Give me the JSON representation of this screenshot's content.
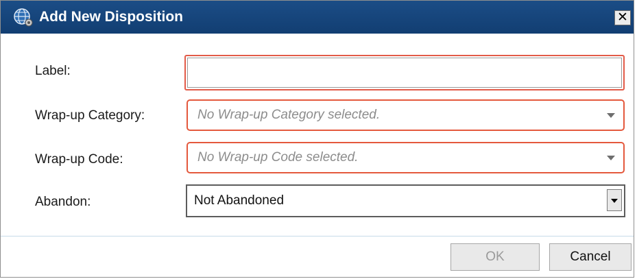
{
  "window": {
    "title": "Add New Disposition",
    "close_label": "✕",
    "icon": "globe-gear-icon"
  },
  "form": {
    "label_field": {
      "label": "Label:",
      "value": ""
    },
    "wrapup_category": {
      "label": "Wrap-up Category:",
      "placeholder": "No Wrap-up Category selected."
    },
    "wrapup_code": {
      "label": "Wrap-up Code:",
      "placeholder": "No Wrap-up Code selected."
    },
    "abandon": {
      "label": "Abandon:",
      "selected": "Not Abandoned"
    }
  },
  "buttons": {
    "ok_label": "OK",
    "cancel_label": "Cancel"
  },
  "colors": {
    "titlebar": "#123e72",
    "invalid_border": "#e25b48",
    "divider": "#c7dbe8"
  }
}
